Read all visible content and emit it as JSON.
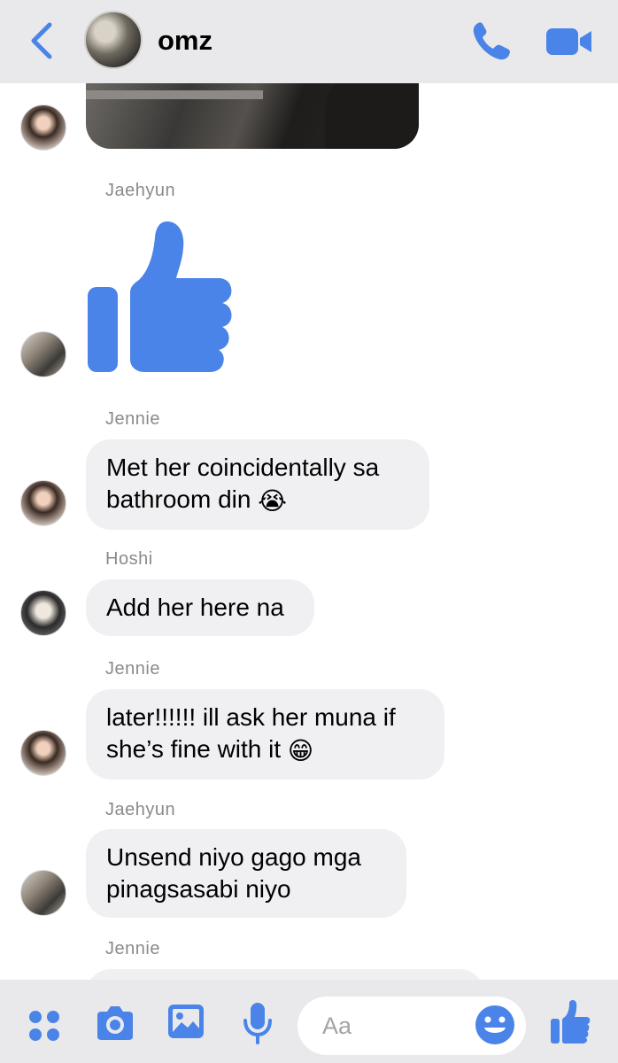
{
  "header": {
    "title": "omz",
    "back_icon": "chevron-left-icon",
    "call_icon": "phone-icon",
    "video_icon": "video-camera-icon"
  },
  "messages": [
    {
      "sender": "",
      "type": "image"
    },
    {
      "sender": "Jaehyun",
      "type": "like"
    },
    {
      "sender": "Jennie",
      "lines": [
        "Met her coincidentally sa",
        "bathroom din"
      ],
      "emoji": "😭"
    },
    {
      "sender": "Hoshi",
      "lines": [
        "Add her here na"
      ]
    },
    {
      "sender": "Jennie",
      "lines": [
        "later!!!!!! ill ask her muna if",
        "she’s fine with it"
      ],
      "emoji": "😁"
    },
    {
      "sender": "Jaehyun",
      "lines": [
        "Unsend niyo gago mga",
        "pinagsasabi niyo"
      ]
    },
    {
      "sender": "Jennie",
      "type": "partial"
    }
  ],
  "composer": {
    "placeholder": "Aa",
    "icons": [
      "apps-icon",
      "camera-icon",
      "gallery-icon",
      "microphone-icon",
      "emoji-icon",
      "like-icon"
    ]
  },
  "colors": {
    "accent": "#4a84e8",
    "bubble": "#f0f0f2",
    "bar": "#e9e9eb"
  }
}
